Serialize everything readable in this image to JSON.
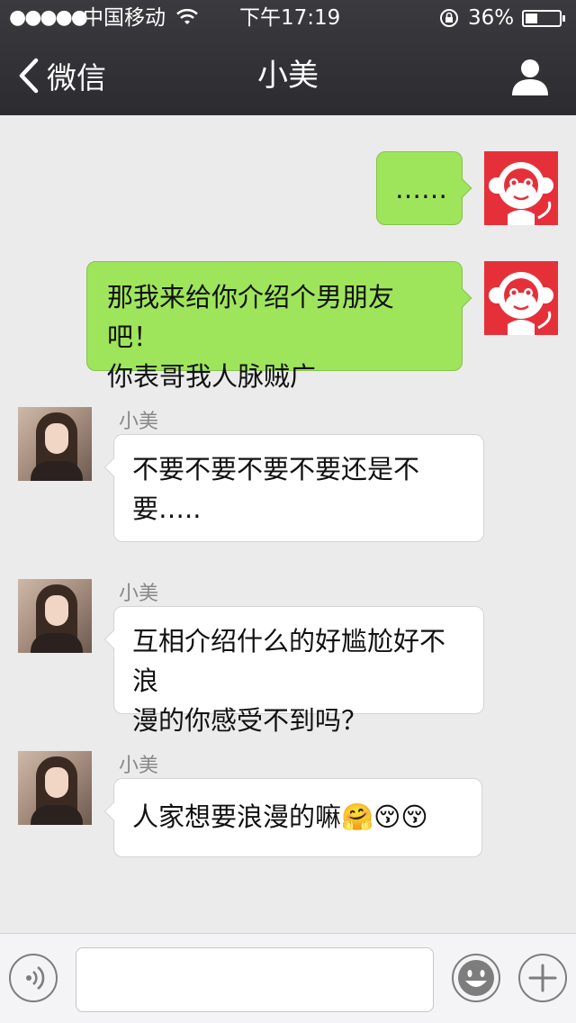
{
  "status_bar": {
    "signal": "●●●●●",
    "carrier": "中国移动",
    "time": "下午17:19",
    "battery_percent": "36%",
    "battery_level": 0.36
  },
  "nav": {
    "back_label": "微信",
    "title": "小美"
  },
  "messages": [
    {
      "direction": "outgoing",
      "text": "……"
    },
    {
      "direction": "outgoing",
      "text": "那我来给你介绍个男朋友吧！\n你表哥我人脉贼广"
    },
    {
      "direction": "incoming",
      "sender": "小美",
      "text": "不要不要不要不要还是不\n要….."
    },
    {
      "direction": "incoming",
      "sender": "小美",
      "text": "互相介绍什么的好尴尬好不浪\n漫的你感受不到吗？"
    },
    {
      "direction": "incoming",
      "sender": "小美",
      "text": "人家想要浪漫的嘛🤗😚😚"
    }
  ],
  "colors": {
    "outgoing_bubble": "#9fe55b",
    "incoming_bubble": "#ffffff",
    "chat_background": "#ebebeb",
    "nav_background": "#2f2f33",
    "avatar_red": "#e5303a"
  },
  "icons": {
    "back": "chevron-left-icon",
    "profile": "person-icon",
    "voice": "voice-icon",
    "emoji": "smiley-icon",
    "more": "plus-icon",
    "my_avatar": "monkey-avatar"
  },
  "input": {
    "value": "",
    "placeholder": ""
  }
}
